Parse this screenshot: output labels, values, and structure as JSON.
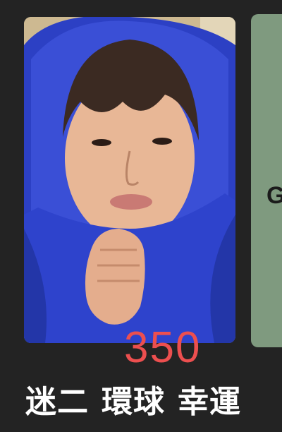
{
  "price": "350",
  "caption": {
    "word1": "迷二",
    "word2": "環球",
    "word3": "幸運"
  },
  "side_card": {
    "letter": "G"
  },
  "colors": {
    "background": "#232323",
    "price": "#ec4f4f",
    "caption": "#ffffff",
    "hoodie": "#2f45c9",
    "side_card": "#7f9a7f"
  }
}
